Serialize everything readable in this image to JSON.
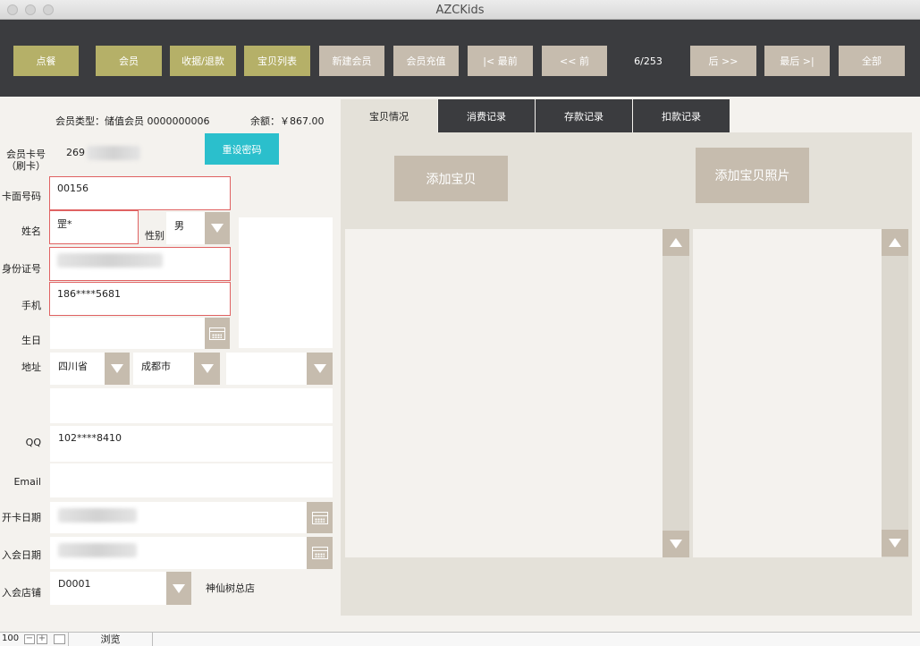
{
  "window": {
    "title": "AZCKids"
  },
  "toolbar": {
    "buttons": [
      {
        "label": "点餐"
      },
      {
        "label": "会员"
      },
      {
        "label": "收据/退款"
      },
      {
        "label": "宝贝列表"
      },
      {
        "label": "新建会员"
      },
      {
        "label": "会员充值"
      },
      {
        "label": "|< 最前"
      },
      {
        "label": "<< 前"
      },
      {
        "label": "后 >>"
      },
      {
        "label": "最后 >|"
      },
      {
        "label": "全部"
      }
    ],
    "record_counter": "6/253"
  },
  "member": {
    "type_text": "会员类型：储值会员 0000000006",
    "balance_text": "余额：￥867.00",
    "card_no_label": "会员卡号",
    "card_no_sublabel": "（刷卡）",
    "card_no_value": "269",
    "reset_password_label": "重设密码",
    "card_face_label": "卡面号码",
    "card_face_value": "00156",
    "name_label": "姓名",
    "name_value": "罡*",
    "gender_label": "性别",
    "gender_value": "男",
    "id_label": "身份证号",
    "mobile_label": "手机",
    "mobile_value": "186****5681",
    "birthday_label": "生日",
    "address_label": "地址",
    "province_value": "四川省",
    "city_value": "成都市",
    "qq_label": "QQ",
    "qq_value": "102****8410",
    "email_label": "Email",
    "open_date_label": "开卡日期",
    "join_date_label": "入会日期",
    "join_store_label": "入会店铺",
    "store_code_value": "D0001",
    "store_name_value": "神仙树总店"
  },
  "tabs": [
    {
      "label": "宝贝情况",
      "active": true
    },
    {
      "label": "消费记录",
      "active": false
    },
    {
      "label": "存款记录",
      "active": false
    },
    {
      "label": "扣款记录",
      "active": false
    }
  ],
  "baby": {
    "add_baby_label": "添加宝贝",
    "add_photo_label": "添加宝贝照片"
  },
  "statusbar": {
    "zoom": "100",
    "mode": "浏览"
  },
  "colors": {
    "toolbar_bg": "#3b3c3f",
    "olive_button": "#b5b068",
    "grey_button": "#c6bcae",
    "accent_cyan": "#2bbfcc",
    "required_border": "#e06262",
    "panel_bg": "#e4e1d9"
  }
}
